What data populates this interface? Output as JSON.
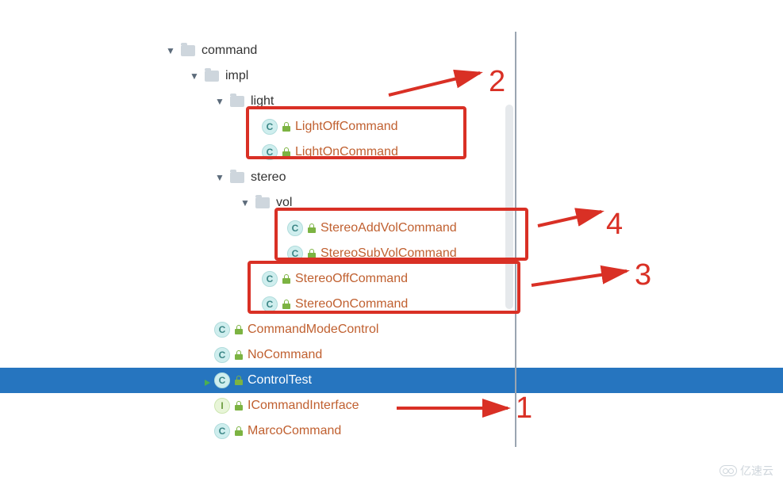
{
  "tree": {
    "command": {
      "label": "command"
    },
    "impl": {
      "label": "impl"
    },
    "light": {
      "label": "light"
    },
    "lightOff": {
      "label": "LightOffCommand"
    },
    "lightOn": {
      "label": "LightOnCommand"
    },
    "stereo": {
      "label": "stereo"
    },
    "vol": {
      "label": "vol"
    },
    "stereoAddVol": {
      "label": "StereoAddVolCommand"
    },
    "stereoSubVol": {
      "label": "StereoSubVolCommand"
    },
    "stereoOff": {
      "label": "StereoOffCommand"
    },
    "stereoOn": {
      "label": "StereoOnCommand"
    },
    "commandModeControl": {
      "label": "CommandModeControl"
    },
    "noCommand": {
      "label": "NoCommand"
    },
    "controlTest": {
      "label": "ControlTest"
    },
    "iCommandInterface": {
      "label": "ICommandInterface"
    },
    "marcoCommand": {
      "label": "MarcoCommand"
    }
  },
  "icons": {
    "classLetter": "C",
    "interfaceLetter": "I",
    "chevronDown": "▼"
  },
  "annotations": {
    "n1": "1",
    "n2": "2",
    "n3": "3",
    "n4": "4"
  },
  "watermark": {
    "text": "亿速云"
  }
}
